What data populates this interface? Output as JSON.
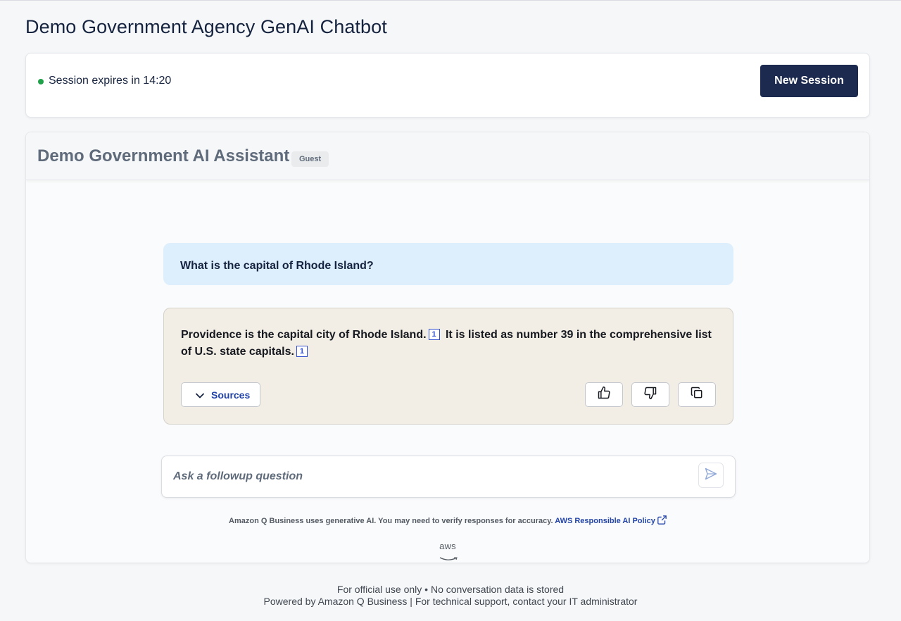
{
  "page": {
    "title": "Demo Government Agency GenAI Chatbot"
  },
  "session": {
    "status_text": "Session expires in 14:20",
    "status_color": "#1fa049",
    "new_session_label": "New Session"
  },
  "chat": {
    "assistant_title": "Demo Government AI Assistant",
    "role_badge": "Guest",
    "user_message": "What is the capital of Rhode Island?",
    "bot_message": {
      "sentence_1": "Providence is the capital city of Rhode Island.",
      "citation_1": "1",
      "sentence_2": "It is listed as number 39 in the comprehensive list of U.S. state capitals.",
      "citation_2": "1"
    },
    "sources_label": "Sources",
    "actions": {
      "thumbs_up_icon": "thumbs-up-icon",
      "thumbs_down_icon": "thumbs-down-icon",
      "copy_icon": "copy-icon"
    },
    "followup_placeholder": "Ask a followup question",
    "disclaimer_text": "Amazon Q Business uses generative AI. You may need to verify responses for accuracy.",
    "policy_link": "AWS Responsible AI Policy",
    "logo_text": "aws"
  },
  "footer": {
    "line_1": "For official use only • No conversation data is stored",
    "line_2": "Powered by Amazon Q Business | For technical support, contact your IT administrator"
  },
  "colors": {
    "primary_button": "#1b2a4e",
    "link": "#2244aa",
    "user_bubble": "#ddeefc",
    "bot_bubble": "#f2ede5"
  }
}
